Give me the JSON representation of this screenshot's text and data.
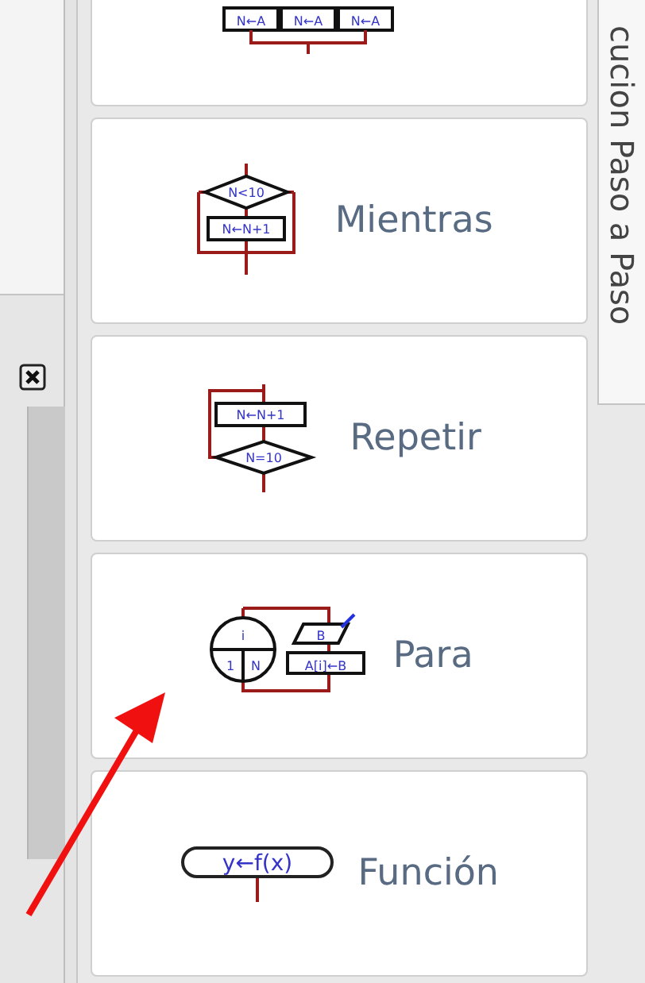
{
  "cards": [
    {
      "kind": "segun",
      "diagram_labels": [
        "N←A",
        "N←A",
        "N←A"
      ]
    },
    {
      "kind": "mientras",
      "label": "Mientras",
      "diagram_labels": [
        "N<10",
        "N←N+1"
      ]
    },
    {
      "kind": "repetir",
      "label": "Repetir",
      "diagram_labels": [
        "N←N+1",
        "N=10"
      ]
    },
    {
      "kind": "para",
      "label": "Para",
      "diagram_labels": [
        "i",
        "B",
        "1",
        "N",
        "A[i]←B"
      ]
    },
    {
      "kind": "funcion",
      "label": "Función",
      "diagram_labels": [
        "y←f(x)"
      ]
    }
  ],
  "side_tab": {
    "label": "cucion Paso a Paso"
  }
}
